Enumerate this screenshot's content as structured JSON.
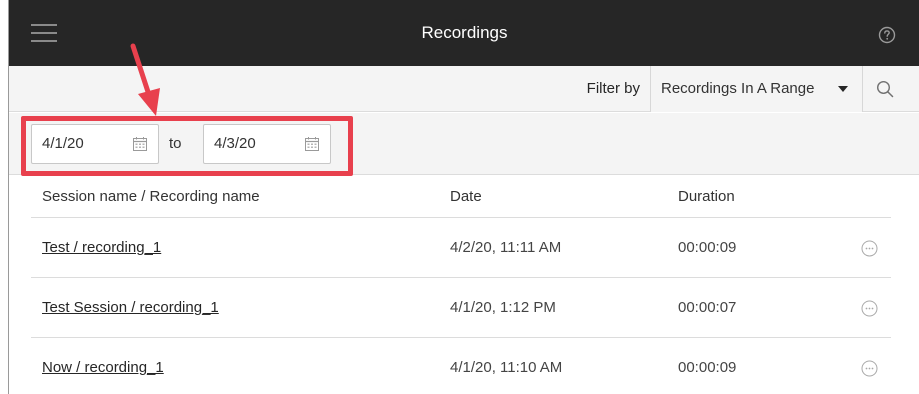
{
  "header": {
    "title": "Recordings",
    "menu_icon": "hamburger-menu-icon",
    "help_icon": "help-question-icon"
  },
  "filter": {
    "label": "Filter by",
    "selected": "Recordings In A Range",
    "search_icon": "search-icon"
  },
  "date_range": {
    "from": "4/1/20",
    "separator": "to",
    "to": "4/3/20",
    "calendar_icon": "calendar-icon"
  },
  "table": {
    "columns": [
      "Session name / Recording name",
      "Date",
      "Duration"
    ],
    "rows": [
      {
        "name": "Test / recording_1",
        "date": "4/2/20, 11:11 AM",
        "duration": "00:00:09"
      },
      {
        "name": "Test Session / recording_1",
        "date": "4/1/20, 1:12 PM",
        "duration": "00:00:07"
      },
      {
        "name": "Now / recording_1",
        "date": "4/1/20, 11:10 AM",
        "duration": "00:00:09"
      }
    ],
    "more_icon": "more-options-icon"
  },
  "colors": {
    "header_bg": "#262626",
    "annotation": "#e8404d",
    "toolbar_bg": "#f4f4f4"
  }
}
